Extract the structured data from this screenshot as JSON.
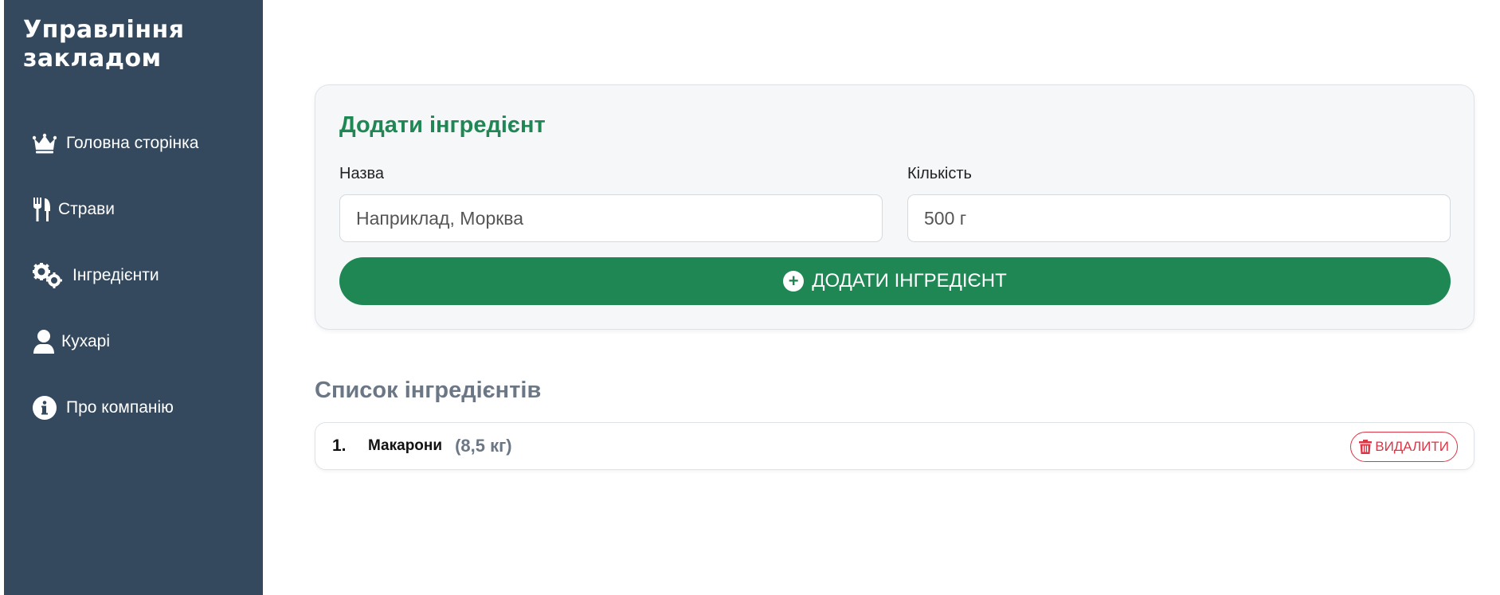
{
  "sidebar": {
    "brand": "Управління закладом",
    "items": [
      {
        "label": "Головна сторінка",
        "icon": "crown-icon"
      },
      {
        "label": "Страви",
        "icon": "utensils-icon"
      },
      {
        "label": "Інгредієнти",
        "icon": "gears-icon"
      },
      {
        "label": "Кухарі",
        "icon": "user-icon"
      },
      {
        "label": "Про компанію",
        "icon": "info-circle-icon"
      }
    ]
  },
  "form": {
    "title": "Додати інгредієнт",
    "name_label": "Назва",
    "name_placeholder": "Наприклад, Морква",
    "qty_label": "Кількість",
    "qty_placeholder": "500 г",
    "submit_label": "ДОДАТИ ІНГРЕДІЄНТ"
  },
  "list": {
    "title": "Список інгредієнтів",
    "items": [
      {
        "num": "1.",
        "name": "Макарони",
        "qty": "(8,5 кг)",
        "delete_label": "ВИДАЛИТИ"
      }
    ]
  },
  "colors": {
    "sidebar_bg": "#34495e",
    "accent_green": "#1e8754",
    "danger_red": "#dc3545"
  }
}
